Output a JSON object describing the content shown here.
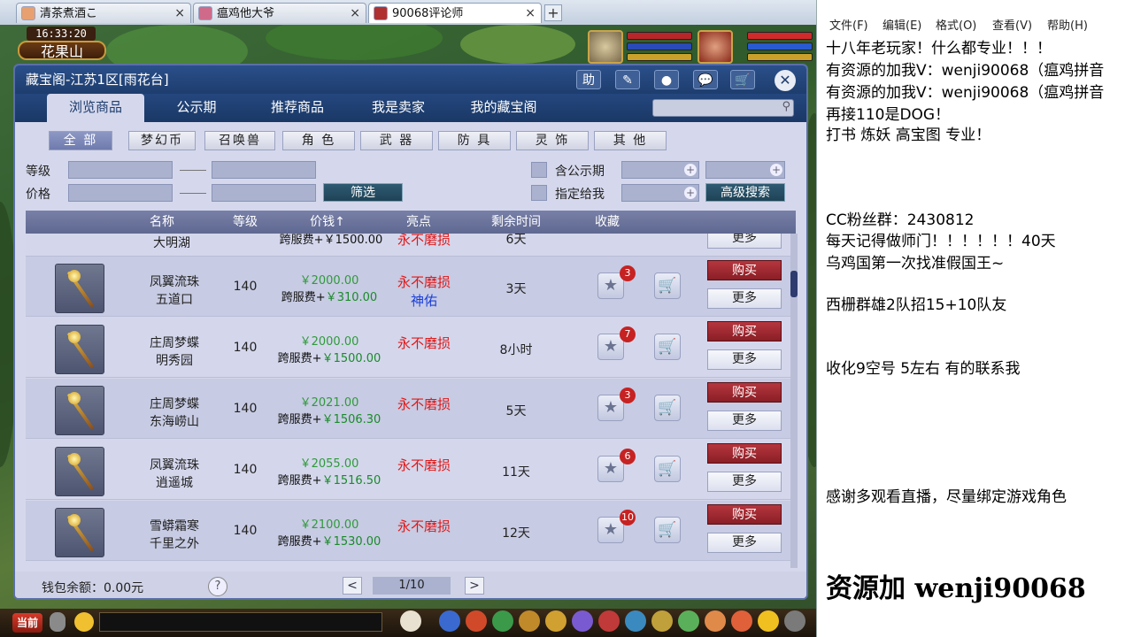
{
  "browser": {
    "tabs": [
      {
        "label": "清茶煮酒こ",
        "active": false
      },
      {
        "label": "瘟鸡他大爷",
        "active": false
      },
      {
        "label": "90068评论师",
        "active": true
      }
    ],
    "close_icon": "×",
    "new_tab": "+"
  },
  "game": {
    "clock": "16:33:20",
    "map_name": "花果山",
    "current_channel": "当前"
  },
  "window": {
    "title": "藏宝阁-江苏1区[雨花台]",
    "title_icons": [
      "助",
      "✎",
      "●",
      "💬",
      "🛒"
    ],
    "close": "✕",
    "nav_tabs": [
      "浏览商品",
      "公示期",
      "推荐商品",
      "我是卖家",
      "我的藏宝阁"
    ],
    "categories": [
      "全 部",
      "梦幻币",
      "召唤兽",
      "角 色",
      "武 器",
      "防 具",
      "灵 饰",
      "其 他"
    ],
    "filters": {
      "level_label": "等级",
      "price_label": "价格",
      "filter_button": "筛选",
      "public_label": "含公示期",
      "designated_label": "指定给我",
      "advanced_search": "高级搜索"
    },
    "columns": [
      "名称",
      "等级",
      "价钱↑",
      "亮点",
      "剩余时间",
      "收藏"
    ],
    "partial_row": {
      "name": "大明湖",
      "price": "跨服费+￥1500.00",
      "highlight": "永不磨损",
      "time": "6天",
      "more": "更多"
    },
    "rows": [
      {
        "name1": "凤翼流珠",
        "name2": "五道口",
        "level": "140",
        "price": "￥2000.00",
        "fee": "跨服费+",
        "fee_value": "￥310.00",
        "highlight": "永不磨损",
        "highlight2": "神佑",
        "time": "3天",
        "favs": "3",
        "buy": "购买",
        "more": "更多"
      },
      {
        "name1": "庄周梦蝶",
        "name2": "明秀园",
        "level": "140",
        "price": "￥2000.00",
        "fee": "跨服费+",
        "fee_value": "￥1500.00",
        "highlight": "永不磨损",
        "highlight2": "",
        "time": "8小时",
        "favs": "7",
        "buy": "购买",
        "more": "更多"
      },
      {
        "name1": "庄周梦蝶",
        "name2": "东海崂山",
        "level": "140",
        "price": "￥2021.00",
        "fee": "跨服费+",
        "fee_value": "￥1506.30",
        "highlight": "永不磨损",
        "highlight2": "",
        "time": "5天",
        "favs": "3",
        "buy": "购买",
        "more": "更多"
      },
      {
        "name1": "凤翼流珠",
        "name2": "逍遥城",
        "level": "140",
        "price": "￥2055.00",
        "fee": "跨服费+",
        "fee_value": "￥1516.50",
        "highlight": "永不磨损",
        "highlight2": "",
        "time": "11天",
        "favs": "6",
        "buy": "购买",
        "more": "更多"
      },
      {
        "name1": "雪蟒霜寒",
        "name2": "千里之外",
        "level": "140",
        "price": "￥2100.00",
        "fee": "跨服费+",
        "fee_value": "￥1530.00",
        "highlight": "永不磨损",
        "highlight2": "",
        "time": "12天",
        "favs": "10",
        "buy": "购买",
        "more": "更多"
      }
    ],
    "footer": {
      "balance": "钱包余额：0.00元",
      "help": "?",
      "page": "1/10",
      "prev": "<",
      "next": ">"
    }
  },
  "notepad": {
    "menu": [
      "文件(F)",
      "编辑(E)",
      "格式(O)",
      "查看(V)",
      "帮助(H)"
    ],
    "lines": [
      "十八年老玩家！什么都专业！！！",
      "有资源的加我V：wenji90068（瘟鸡拼音",
      "有资源的加我V：wenji90068（瘟鸡拼音",
      "再接110是DOG！",
      "打书 炼妖 高宝图 专业！",
      "CC粉丝群：2430812",
      "每天记得做师门！！！！！！40天",
      "乌鸡国第一次找准假国王~",
      "西栅群雄2队招15+10队友",
      "收化9空号 5左右 有的联系我",
      "感谢多观看直播，尽量绑定游戏角色",
      "资源加 wenji90068"
    ]
  },
  "colors": {
    "accent": "#1e3d6e",
    "buy": "#9a2a30",
    "price_green": "#2f9a3a",
    "highlight_red": "#e01818"
  }
}
